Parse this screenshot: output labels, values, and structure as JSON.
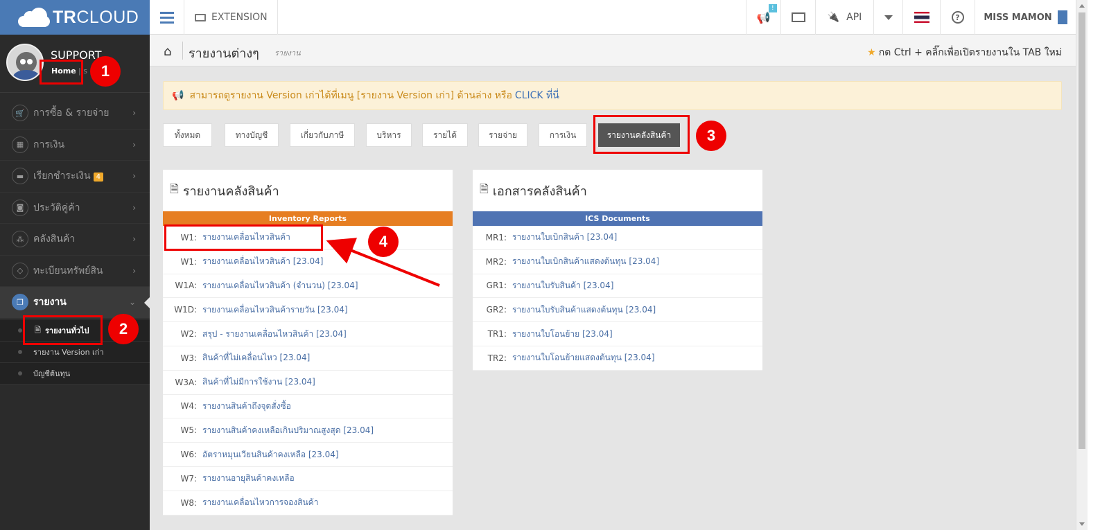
{
  "app": {
    "logo_bold": "TR",
    "logo_light": "CLOUD"
  },
  "topbar": {
    "extension_label": "EXTENSION",
    "notif_badge": "!",
    "api_label": "API",
    "user_name": "MISS MAMON",
    "help_label": "?"
  },
  "profile": {
    "name": "SUPPORT",
    "home_link": "Home",
    "home_sep": "|  s"
  },
  "sidebar": {
    "items": [
      {
        "label": "การซื้อ & รายจ่าย",
        "icon": "cart-icon",
        "glyph": "🛒"
      },
      {
        "label": "การเงิน",
        "icon": "calendar-icon",
        "glyph": "▦"
      },
      {
        "label": "เรียกชำระเงิน",
        "icon": "card-icon",
        "glyph": "▬",
        "badge": "4"
      },
      {
        "label": "ประวัติคู่ค้า",
        "icon": "contact-icon",
        "glyph": "◙"
      },
      {
        "label": "คลังสินค้า",
        "icon": "cubes-icon",
        "glyph": "⁂"
      },
      {
        "label": "ทะเบียนทรัพย์สิน",
        "icon": "diamond-icon",
        "glyph": "◇"
      },
      {
        "label": "รายงาน",
        "icon": "copy-icon",
        "glyph": "❐",
        "active": true
      }
    ],
    "submenu": [
      {
        "label": "รายงานทั่วไป",
        "current": true
      },
      {
        "label": "รายงาน Version เก่า"
      },
      {
        "label": "บัญชีต้นทุน"
      }
    ]
  },
  "header": {
    "title": "รายงานต่างๆ",
    "subtitle": "รายงาน",
    "hint": "กด Ctrl + คลิ๊กเพื่อเปิดรายงานใน TAB ใหม่"
  },
  "alert": {
    "text": "สามารถดูรายงาน Version เก่าได้ที่เมนู [รายงาน Version เก่า] ด้านล่าง หรือ",
    "link": "CLICK ที่นี่"
  },
  "tabs": [
    "ทั้งหมด",
    "ทางบัญชี",
    "เกี่ยวกับภาษี",
    "บริหาร",
    "รายได้",
    "รายจ่าย",
    "การเงิน",
    "รายงานคลังสินค้า"
  ],
  "active_tab": "รายงานคลังสินค้า",
  "inventory_panel": {
    "title": "รายงานคลังสินค้า",
    "band": "Inventory Reports",
    "band_color": "#e67e22",
    "rows": [
      {
        "code": "W1:",
        "name": "รายงานเคลื่อนไหวสินค้า"
      },
      {
        "code": "W1:",
        "name": "รายงานเคลื่อนไหวสินค้า [23.04]"
      },
      {
        "code": "W1A:",
        "name": "รายงานเคลื่อนไหวสินค้า (จำนวน) [23.04]"
      },
      {
        "code": "W1D:",
        "name": "รายงานเคลื่อนไหวสินค้ารายวัน [23.04]"
      },
      {
        "code": "W2:",
        "name": "สรุป - รายงานเคลื่อนไหวสินค้า [23.04]"
      },
      {
        "code": "W3:",
        "name": "สินค้าที่ไม่เคลื่อนไหว [23.04]"
      },
      {
        "code": "W3A:",
        "name": "สินค้าที่ไม่มีการใช้งาน [23.04]"
      },
      {
        "code": "W4:",
        "name": "รายงานสินค้าถึงจุดสั่งซื้อ"
      },
      {
        "code": "W5:",
        "name": "รายงานสินค้าคงเหลือเกินปริมาณสูงสุด [23.04]"
      },
      {
        "code": "W6:",
        "name": "อัตราหมุนเวียนสินค้าคงเหลือ [23.04]"
      },
      {
        "code": "W7:",
        "name": "รายงานอายุสินค้าคงเหลือ"
      },
      {
        "code": "W8:",
        "name": "รายงานเคลื่อนไหวการจองสินค้า"
      }
    ]
  },
  "ics_panel": {
    "title": "เอกสารคลังสินค้า",
    "band": "ICS Documents",
    "band_color": "#4f73b3",
    "rows": [
      {
        "code": "MR1:",
        "name": "รายงานใบเบิกสินค้า [23.04]"
      },
      {
        "code": "MR2:",
        "name": "รายงานใบเบิกสินค้าแสดงต้นทุน [23.04]"
      },
      {
        "code": "GR1:",
        "name": "รายงานใบรับสินค้า [23.04]"
      },
      {
        "code": "GR2:",
        "name": "รายงานใบรับสินค้าแสดงต้นทุน [23.04]"
      },
      {
        "code": "TR1:",
        "name": "รายงานใบโอนย้าย [23.04]"
      },
      {
        "code": "TR2:",
        "name": "รายงานใบโอนย้ายแสดงต้นทุน [23.04]"
      }
    ]
  },
  "annotations": [
    "1",
    "2",
    "3",
    "4"
  ],
  "colors": {
    "sidebar_bg": "#2b2b2b",
    "brand_blue": "#4a7ab5",
    "annotation_red": "#ee0000",
    "alert_bg": "#fcf1d8"
  }
}
